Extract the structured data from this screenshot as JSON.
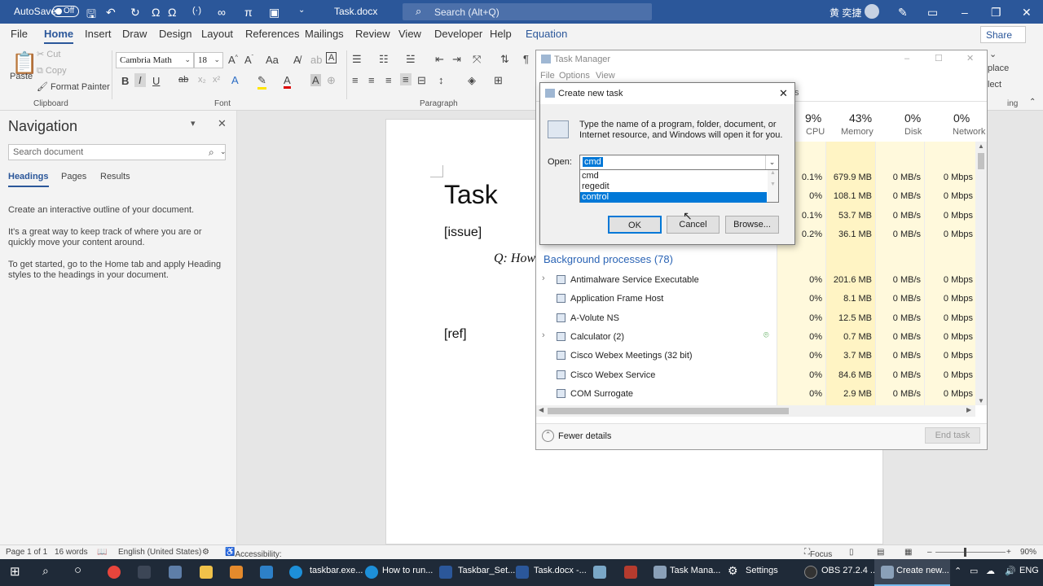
{
  "titlebar": {
    "autosave": "AutoSave",
    "toggle": "Off",
    "filename": "Task.docx",
    "search_placeholder": "Search (Alt+Q)",
    "user": "黄 奕捷"
  },
  "menu": {
    "items": [
      "File",
      "Home",
      "Insert",
      "Draw",
      "Design",
      "Layout",
      "References",
      "Mailings",
      "Review",
      "View",
      "Developer",
      "Help",
      "Equation"
    ],
    "share": "Share"
  },
  "ribbon": {
    "clipboard": {
      "paste": "Paste",
      "cut": "Cut",
      "copy": "Copy",
      "format_painter": "Format Painter",
      "group": "Clipboard"
    },
    "font": {
      "family": "Cambria Math",
      "size": "18",
      "group": "Font"
    },
    "paragraph": {
      "group": "Paragraph"
    },
    "editing": {
      "replace": "place",
      "select": "lect",
      "group": "ing"
    }
  },
  "navigation": {
    "title": "Navigation",
    "search_placeholder": "Search document",
    "tabs": [
      "Headings",
      "Pages",
      "Results"
    ],
    "p1": "Create an interactive outline of your document.",
    "p2": "It's a great way to keep track of where you are or quickly move your content around.",
    "p3": "To get started, go to the Home tab and apply Heading styles to the headings in your document."
  },
  "document": {
    "title": "Task",
    "issue": "[issue]",
    "equation": "Q: How",
    "ref": "[ref]"
  },
  "task_manager": {
    "title": "Task Manager",
    "menu": [
      "File",
      "Options",
      "View"
    ],
    "columns": [
      {
        "pct": "9%",
        "label": "CPU"
      },
      {
        "pct": "43%",
        "label": "Memory"
      },
      {
        "pct": "0%",
        "label": "Disk"
      },
      {
        "pct": "0%",
        "label": "Network"
      }
    ],
    "top_rows": [
      {
        "cpu": "0.1%",
        "mem": "679.9 MB",
        "disk": "0 MB/s",
        "net": "0 Mbps"
      },
      {
        "cpu": "0%",
        "mem": "108.1 MB",
        "disk": "0 MB/s",
        "net": "0 Mbps"
      },
      {
        "cpu": "0.1%",
        "mem": "53.7 MB",
        "disk": "0 MB/s",
        "net": "0 Mbps"
      },
      {
        "cpu": "0.2%",
        "mem": "36.1 MB",
        "disk": "0 MB/s",
        "net": "0 Mbps"
      }
    ],
    "section": "Background processes (78)",
    "processes": [
      {
        "name": "Antimalware Service Executable",
        "cpu": "0%",
        "mem": "201.6 MB",
        "disk": "0 MB/s",
        "net": "0 Mbps",
        "expand": true
      },
      {
        "name": "Application Frame Host",
        "cpu": "0%",
        "mem": "8.1 MB",
        "disk": "0 MB/s",
        "net": "0 Mbps",
        "expand": false
      },
      {
        "name": "A-Volute NS",
        "cpu": "0%",
        "mem": "12.5 MB",
        "disk": "0 MB/s",
        "net": "0 Mbps",
        "expand": false
      },
      {
        "name": "Calculator (2)",
        "cpu": "0%",
        "mem": "0.7 MB",
        "disk": "0 MB/s",
        "net": "0 Mbps",
        "expand": true
      },
      {
        "name": "Cisco Webex Meetings (32 bit)",
        "cpu": "0%",
        "mem": "3.7 MB",
        "disk": "0 MB/s",
        "net": "0 Mbps",
        "expand": false
      },
      {
        "name": "Cisco Webex Service",
        "cpu": "0%",
        "mem": "84.6 MB",
        "disk": "0 MB/s",
        "net": "0 Mbps",
        "expand": false
      },
      {
        "name": "COM Surrogate",
        "cpu": "0%",
        "mem": "2.9 MB",
        "disk": "0 MB/s",
        "net": "0 Mbps",
        "expand": false
      }
    ],
    "fewer_details": "Fewer details",
    "end_task": "End task",
    "tab_fragment": "s"
  },
  "dialog": {
    "title": "Create new task",
    "message": "Type the name of a program, folder, document, or Internet resource, and Windows will open it for you.",
    "open_label": "Open:",
    "value": "cmd",
    "options": [
      "cmd",
      "regedit",
      "control"
    ],
    "ok": "OK",
    "cancel": "Cancel",
    "browse": "Browse..."
  },
  "statusbar": {
    "page": "Page 1 of 1",
    "words": "16 words",
    "language": "English (United States)",
    "accessibility": "Accessibility: Good to go",
    "focus": "Focus",
    "zoom": "90%"
  },
  "taskbar": {
    "items": [
      "taskbar.exe...",
      "How to run...",
      "Taskbar_Set...",
      "Task.docx -...",
      "Task Mana...",
      "Settings",
      "OBS 27.2.4 ...",
      "Create new..."
    ],
    "lang": "ENG"
  }
}
